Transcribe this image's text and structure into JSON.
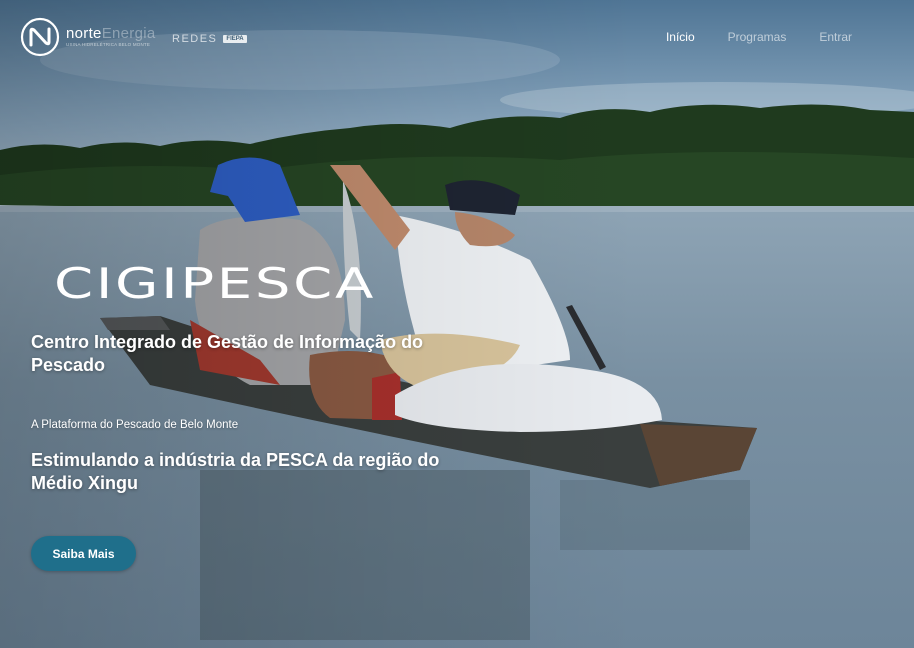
{
  "header": {
    "brand": {
      "name": "norte",
      "name_faded": "Energia",
      "sub": "USINA HIDRELÉTRICA BELO MONTE"
    },
    "partner": {
      "name": "REDES",
      "badge": "FIEPA"
    },
    "nav": [
      {
        "label": "Início",
        "active": true
      },
      {
        "label": "Programas",
        "active": false
      },
      {
        "label": "Entrar",
        "active": false
      }
    ]
  },
  "hero": {
    "title": "CIGIPESCA",
    "subtitle": "Centro Integrado de Gestão de Informação do Pescado",
    "tagline": "A Plataforma do Pescado de Belo Monte",
    "headline": "Estimulando a indústria da PESCA da região do Médio Xingu",
    "cta_label": "Saiba Mais"
  },
  "colors": {
    "accent": "#1f6f8b",
    "text": "#ffffff"
  }
}
